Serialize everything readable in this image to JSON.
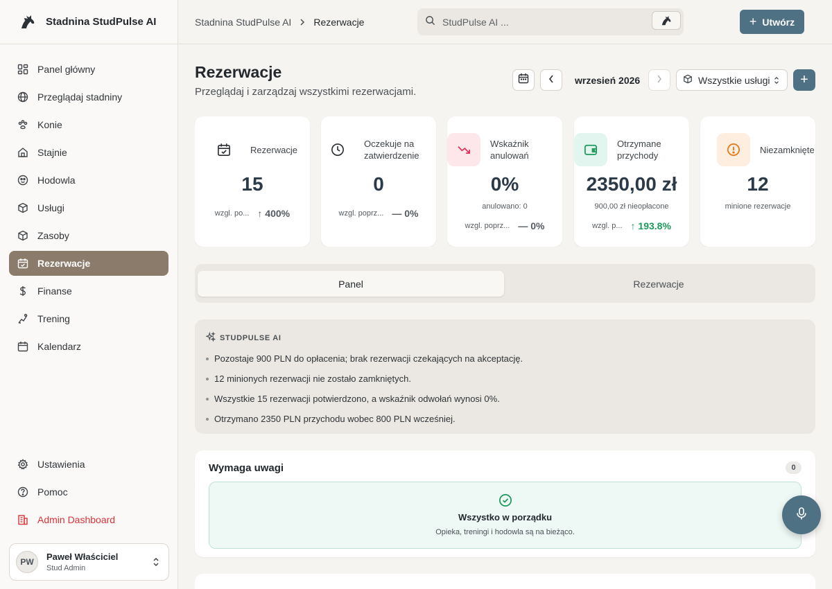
{
  "app": {
    "name": "Stadnina StudPulse AI"
  },
  "sidebar": {
    "items": [
      {
        "label": "Panel główny",
        "icon": "dashboard-icon"
      },
      {
        "label": "Przeglądaj stadniny",
        "icon": "globe-icon"
      },
      {
        "label": "Konie",
        "icon": "paw-icon"
      },
      {
        "label": "Stajnie",
        "icon": "home-icon"
      },
      {
        "label": "Hodowla",
        "icon": "breeding-icon"
      },
      {
        "label": "Usługi",
        "icon": "box-icon"
      },
      {
        "label": "Zasoby",
        "icon": "box-icon"
      },
      {
        "label": "Rezerwacje",
        "icon": "calendar-check-icon",
        "active": true
      },
      {
        "label": "Finanse",
        "icon": "dollar-icon"
      },
      {
        "label": "Trening",
        "icon": "training-icon"
      },
      {
        "label": "Kalendarz",
        "icon": "calendar-icon"
      }
    ],
    "bottom": [
      {
        "label": "Ustawienia",
        "icon": "gear-icon"
      },
      {
        "label": "Pomoc",
        "icon": "help-icon"
      },
      {
        "label": "Admin Dashboard",
        "icon": "building-icon"
      }
    ],
    "user": {
      "initials": "PW",
      "name": "Paweł Właściciel",
      "role": "Stud Admin"
    }
  },
  "topbar": {
    "breadcrumb": [
      "Stadnina StudPulse AI",
      "Rezerwacje"
    ],
    "search_placeholder": "StudPulse AI ...",
    "create_label": "Utwórz"
  },
  "page": {
    "title": "Rezerwacje",
    "subtitle": "Przeglądaj i zarządzaj wszystkimi rezerwacjami.",
    "month": "wrzesień 2026",
    "service_filter": "Wszystkie usługi"
  },
  "stats": [
    {
      "label": "Rezerwacje",
      "value": "15",
      "compare_label": "wzgl. po...",
      "delta": "400%",
      "delta_dir": "up"
    },
    {
      "label": "Oczekuje na zatwierdzenie",
      "value": "0",
      "compare_label": "wzgl. poprz...",
      "delta": "0%",
      "delta_dir": "flat"
    },
    {
      "label": "Wskaźnik anulowań",
      "value": "0%",
      "note": "anulowano: 0",
      "compare_label": "wzgl. poprz...",
      "delta": "0%",
      "delta_dir": "flat"
    },
    {
      "label": "Otrzymane przychody",
      "value": "2350,00 zł",
      "note": "900,00 zł nieopłacone",
      "compare_label": "wzgl. p...",
      "delta": "193.8%",
      "delta_dir": "up-green"
    },
    {
      "label": "Niezamknięte",
      "value": "12",
      "note": "minione rezerwacje"
    }
  ],
  "tabs": [
    {
      "label": "Panel",
      "active": true
    },
    {
      "label": "Rezerwacje",
      "active": false
    }
  ],
  "ai": {
    "title": "STUDPULSE AI",
    "items": [
      "Pozostaje 900 PLN do opłacenia; brak rezerwacji czekających na akceptację.",
      "12 minionych rezerwacji nie zostało zamkniętych.",
      "Wszystkie 15 rezerwacji potwierdzono, a wskaźnik odwołań wynosi 0%.",
      "Otrzymano 2350 PLN przychodu wobec 800 PLN wcześniej."
    ]
  },
  "attention": {
    "title": "Wymaga uwagi",
    "count": "0",
    "ok_title": "Wszystko w porządku",
    "ok_sub": "Opieka, treningi i hodowla są na bieżąco."
  },
  "colors": {
    "accent": "#4f7184",
    "active_nav": "#8b7b6a",
    "danger": "#d9333a",
    "success": "#1a9b5a"
  }
}
